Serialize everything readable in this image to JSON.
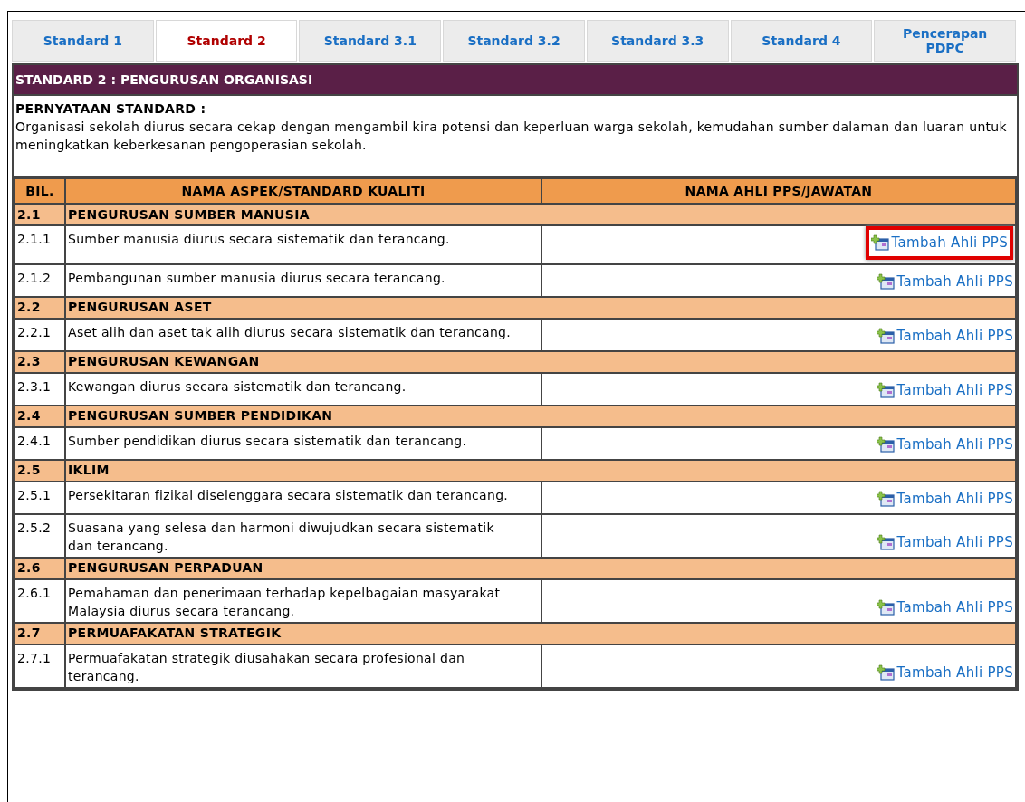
{
  "tabs": [
    {
      "label": "Standard 1",
      "selected": false
    },
    {
      "label": "Standard 2",
      "selected": true
    },
    {
      "label": "Standard 3.1",
      "selected": false
    },
    {
      "label": "Standard 3.2",
      "selected": false
    },
    {
      "label": "Standard 3.3",
      "selected": false
    },
    {
      "label": "Standard 4",
      "selected": false
    },
    {
      "label": "Pencerapan PDPC",
      "selected": false
    }
  ],
  "title": "STANDARD 2 : PENGURUSAN ORGANISASI",
  "statement": {
    "heading": "PERNYATAAN STANDARD :",
    "text": "Organisasi sekolah diurus secara cekap dengan mengambil kira potensi dan keperluan warga sekolah, kemudahan sumber dalaman dan luaran untuk meningkatkan keberkesanan pengoperasian sekolah."
  },
  "table": {
    "columns": [
      "BIL.",
      "NAMA ASPEK/STANDARD KUALITI",
      "NAMA AHLI PPS/JAWATAN"
    ],
    "sections": [
      {
        "number": "2.1",
        "title": "PENGURUSAN SUMBER MANUSIA",
        "rows": [
          {
            "number": "2.1.1",
            "text": "Sumber manusia diurus secara sistematik dan terancang.",
            "action": "Tambah Ahli PPS",
            "highlighted": true
          },
          {
            "number": "2.1.2",
            "text": "Pembangunan sumber manusia diurus secara terancang.",
            "action": "Tambah Ahli PPS",
            "highlighted": false
          }
        ]
      },
      {
        "number": "2.2",
        "title": "PENGURUSAN ASET",
        "rows": [
          {
            "number": "2.2.1",
            "text": "Aset alih dan aset tak alih diurus secara sistematik dan terancang.",
            "action": "Tambah Ahli PPS",
            "highlighted": false
          }
        ]
      },
      {
        "number": "2.3",
        "title": "PENGURUSAN KEWANGAN",
        "rows": [
          {
            "number": "2.3.1",
            "text": "Kewangan diurus secara sistematik dan terancang.",
            "action": "Tambah Ahli PPS",
            "highlighted": false
          }
        ]
      },
      {
        "number": "2.4",
        "title": "PENGURUSAN SUMBER PENDIDIKAN",
        "rows": [
          {
            "number": "2.4.1",
            "text": "Sumber pendidikan diurus secara sistematik dan terancang.",
            "action": "Tambah Ahli PPS",
            "highlighted": false
          }
        ]
      },
      {
        "number": "2.5",
        "title": "IKLIM",
        "rows": [
          {
            "number": "2.5.1",
            "text": "Persekitaran fizikal diselenggara secara sistematik dan terancang.",
            "action": "Tambah Ahli PPS",
            "highlighted": false
          },
          {
            "number": "2.5.2",
            "text": "Suasana yang selesa dan harmoni diwujudkan secara sistematik dan terancang.",
            "action": "Tambah Ahli PPS",
            "highlighted": false
          }
        ]
      },
      {
        "number": "2.6",
        "title": "PENGURUSAN PERPADUAN",
        "rows": [
          {
            "number": "2.6.1",
            "text": "Pemahaman dan penerimaan terhadap kepelbagaian masyarakat Malaysia diurus secara terancang.",
            "action": "Tambah Ahli PPS",
            "highlighted": false
          }
        ]
      },
      {
        "number": "2.7",
        "title": "PERMUAFAKATAN STRATEGIK",
        "rows": [
          {
            "number": "2.7.1",
            "text": "Permuafakatan strategik diusahakan secara profesional dan terancang.",
            "action": "Tambah Ahli PPS",
            "highlighted": false
          }
        ]
      }
    ]
  }
}
